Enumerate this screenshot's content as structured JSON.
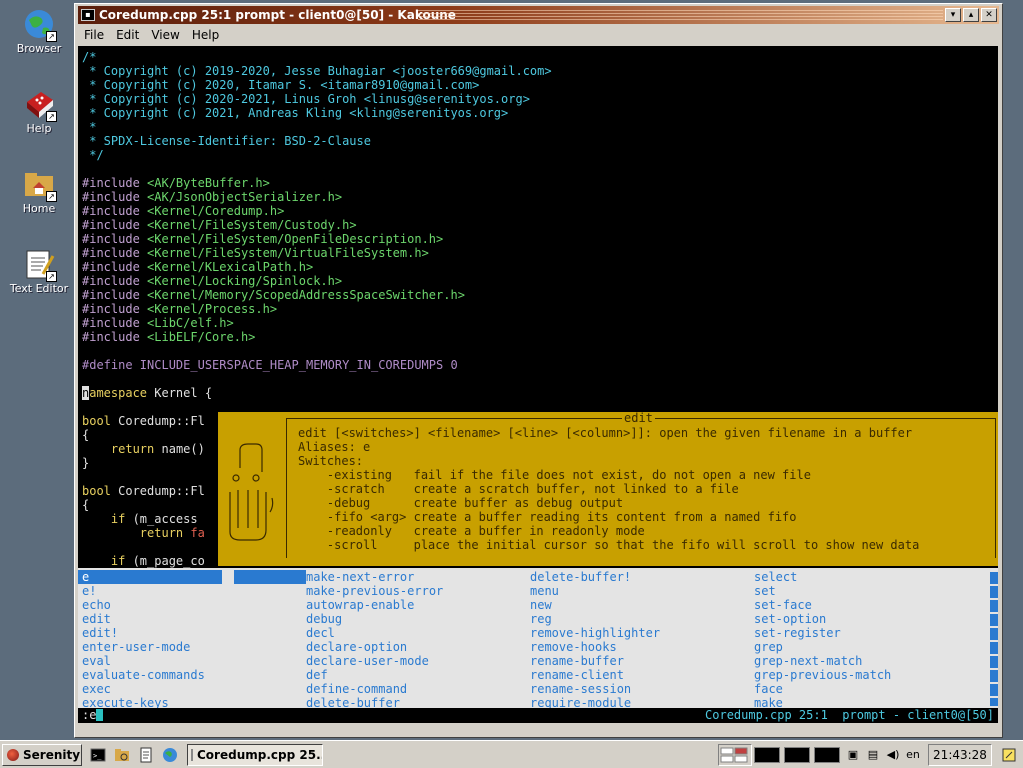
{
  "desktop": {
    "icons": [
      {
        "label": "Browser",
        "icon": "globe-icon"
      },
      {
        "label": "Help",
        "icon": "book-icon"
      },
      {
        "label": "Home",
        "icon": "home-folder-icon"
      },
      {
        "label": "Text Editor",
        "icon": "text-editor-icon"
      }
    ]
  },
  "window": {
    "title": "Coredump.cpp 25:1  prompt - client0@[50] - Kakoune",
    "controls": {
      "minimize": "▾",
      "maximize": "▴",
      "close": "✕"
    },
    "menu": [
      "File",
      "Edit",
      "View",
      "Help"
    ]
  },
  "editor": {
    "lines": [
      {
        "text": "/*",
        "cls": "c-comment"
      },
      {
        "text": " * Copyright (c) 2019-2020, Jesse Buhagiar <jooster669@gmail.com>",
        "cls": "c-comment"
      },
      {
        "text": " * Copyright (c) 2020, Itamar S. <itamar8910@gmail.com>",
        "cls": "c-comment"
      },
      {
        "text": " * Copyright (c) 2020-2021, Linus Groh <linusg@serenityos.org>",
        "cls": "c-comment"
      },
      {
        "text": " * Copyright (c) 2021, Andreas Kling <kling@serenityos.org>",
        "cls": "c-comment"
      },
      {
        "text": " *",
        "cls": "c-comment"
      },
      {
        "text": " * SPDX-License-Identifier: BSD-2-Clause",
        "cls": "c-comment"
      },
      {
        "text": " */",
        "cls": "c-comment"
      },
      {
        "text": "",
        "cls": "c-plain"
      },
      {
        "text": "#include <AK/ByteBuffer.h>",
        "cls": "c-inc"
      },
      {
        "text": "#include <AK/JsonObjectSerializer.h>",
        "cls": "c-inc"
      },
      {
        "text": "#include <Kernel/Coredump.h>",
        "cls": "c-inc"
      },
      {
        "text": "#include <Kernel/FileSystem/Custody.h>",
        "cls": "c-inc"
      },
      {
        "text": "#include <Kernel/FileSystem/OpenFileDescription.h>",
        "cls": "c-inc"
      },
      {
        "text": "#include <Kernel/FileSystem/VirtualFileSystem.h>",
        "cls": "c-inc"
      },
      {
        "text": "#include <Kernel/KLexicalPath.h>",
        "cls": "c-inc"
      },
      {
        "text": "#include <Kernel/Locking/Spinlock.h>",
        "cls": "c-inc"
      },
      {
        "text": "#include <Kernel/Memory/ScopedAddressSpaceSwitcher.h>",
        "cls": "c-inc"
      },
      {
        "text": "#include <Kernel/Process.h>",
        "cls": "c-inc"
      },
      {
        "text": "#include <LibC/elf.h>",
        "cls": "c-inc"
      },
      {
        "text": "#include <LibELF/Core.h>",
        "cls": "c-inc"
      },
      {
        "text": "",
        "cls": "c-plain"
      },
      {
        "text": "#define INCLUDE_USERSPACE_HEAP_MEMORY_IN_COREDUMPS 0",
        "cls": "c-define"
      },
      {
        "text": "",
        "cls": "c-plain"
      },
      {
        "text": "namespace Kernel {",
        "cls": "c-ns"
      },
      {
        "text": "",
        "cls": "c-plain"
      },
      {
        "text": "bool Coredump::Fl",
        "cls": "c-bool"
      },
      {
        "text": "{",
        "cls": "c-plain"
      },
      {
        "text": "    return name()",
        "cls": "c-return"
      },
      {
        "text": "}",
        "cls": "c-plain"
      },
      {
        "text": "",
        "cls": "c-plain"
      },
      {
        "text": "bool Coredump::Fl",
        "cls": "c-bool"
      },
      {
        "text": "{",
        "cls": "c-plain"
      },
      {
        "text": "    if (m_access",
        "cls": "c-if"
      },
      {
        "text": "        return fa",
        "cls": "c-retfa"
      },
      {
        "text": "",
        "cls": "c-plain"
      },
      {
        "text": "    if (m_page_co",
        "cls": "c-if"
      }
    ]
  },
  "popup": {
    "title": "edit",
    "lines": [
      "edit [<switches>] <filename> [<line> [<column>]]: open the given filename in a buffer",
      "Aliases: e",
      "Switches:",
      "    -existing   fail if the file does not exist, do not open a new file",
      "    -scratch    create a scratch buffer, not linked to a file",
      "    -debug      create buffer as debug output",
      "    -fifo <arg> create a buffer reading its content from a named fifo",
      "    -readonly   create a buffer in readonly mode",
      "    -scroll     place the initial cursor so that the fifo will scroll to show new data"
    ]
  },
  "completions": {
    "columns": [
      [
        "e",
        "e!",
        "echo",
        "edit",
        "edit!",
        "enter-user-mode",
        "eval",
        "evaluate-commands",
        "exec",
        "execute-keys"
      ],
      [
        "make-next-error",
        "make-previous-error",
        "autowrap-enable",
        "debug",
        "decl",
        "declare-option",
        "declare-user-mode",
        "def",
        "define-command",
        "delete-buffer"
      ],
      [
        "delete-buffer!",
        "menu",
        "new",
        "reg",
        "remove-highlighter",
        "remove-hooks",
        "rename-buffer",
        "rename-client",
        "rename-session",
        "require-module"
      ],
      [
        "select",
        "set",
        "set-face",
        "set-option",
        "set-register",
        "grep",
        "grep-next-match",
        "grep-previous-match",
        "face",
        "make"
      ]
    ]
  },
  "statusline": {
    "prompt": ":e",
    "mode": "Coredump.cpp 25:1  prompt - client0@[50]"
  },
  "taskbar": {
    "start_label": "Serenity",
    "task_label": "Coredump.cpp 25...",
    "keymap": "en",
    "clock": "21:43:28"
  },
  "colors": {
    "accent": "#2a7ad0",
    "popup_bg": "#c8a000",
    "comment": "#4ec9e0",
    "include": "#6dd76d"
  }
}
